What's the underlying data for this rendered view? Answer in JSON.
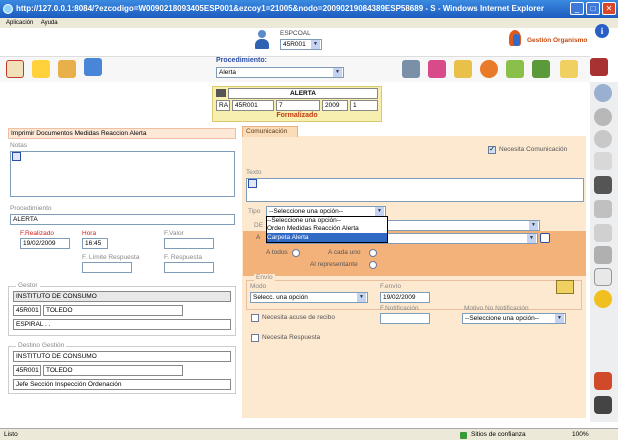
{
  "window": {
    "title": "http://127.0.0.1:8084/?ezcodigo=W0090218093405ESP001&ezcoy1=21005&nodo=20090219084389ESP58689 - S - Windows Internet Explorer"
  },
  "menu": {
    "items": [
      "Aplicación",
      "Ayuda"
    ]
  },
  "header": {
    "espcoal_label": "ESPCOAL",
    "espcoal_value": "45R001",
    "org_label": "Gestión Organismo"
  },
  "procedimiento": {
    "label": "Procedimiento:",
    "value": "Alerta"
  },
  "banner": {
    "title": "ALERTA",
    "c1": "RA",
    "c2": "45R001",
    "c3": "7",
    "c4": "2009",
    "c5": "1",
    "status": "Formalizado"
  },
  "left": {
    "title": "Imprimir Documentos Medidas Reaccion Alerta",
    "notas_label": "Notas",
    "proc_label": "Procedimiento",
    "proc_value": "ALERTA",
    "frealizado_label": "F.Realizado",
    "frealizado_value": "19/02/2009",
    "hora_label": "Hora",
    "hora_value": "16:45",
    "fvalor_label": "F.Valor",
    "flimite_label": "F. Límite Respuesta",
    "frespuesta_label": "F. Respuesta",
    "gestor_legend": "Gestor",
    "gestor_name": "INSTITUTO DE CONSUMO",
    "gestor_code": "45R001",
    "gestor_city": "TOLEDO",
    "gestor_person": "ESPIRAL . .",
    "destino_legend": "Destino Gestión",
    "destino_name": "INSTITUTO DE CONSUMO",
    "destino_code": "45R001",
    "destino_city": "TOLEDO",
    "destino_person": "Jefe Sección Inspección Ordenación"
  },
  "right": {
    "tab": "Comunicación",
    "necesita_com": "Necesita Comunicación",
    "texto_label": "Texto",
    "tipo_label": "Tipo",
    "tipo_value": "--Seleccione una opción--",
    "tipo_options": [
      "--Seleccione una opción--",
      "Orden Medidas Reacción Alerta",
      "Carpeta Alerta"
    ],
    "de_label": "DE",
    "a_label": "A",
    "a_todos": "A todos",
    "a_cada_uno": "A cada uno",
    "al_representante": "Al representante",
    "envio_legend": "Envío",
    "modo_label": "Modo",
    "modo_value": "Selecc. una opción",
    "fenvio_label": "F.envío",
    "fenvio_value": "19/02/2009",
    "acuse": "Necesita acuse de recibo",
    "fnotif_label": "F.Notificación",
    "motivo_label": "Motivo No Notificación",
    "motivo_value": "--Seleccione una opción--",
    "necesita_resp": "Necesita Respuesta"
  },
  "statusbar": {
    "left": "Listo",
    "zone": "Sitios de confianza",
    "zoom": "100%"
  }
}
